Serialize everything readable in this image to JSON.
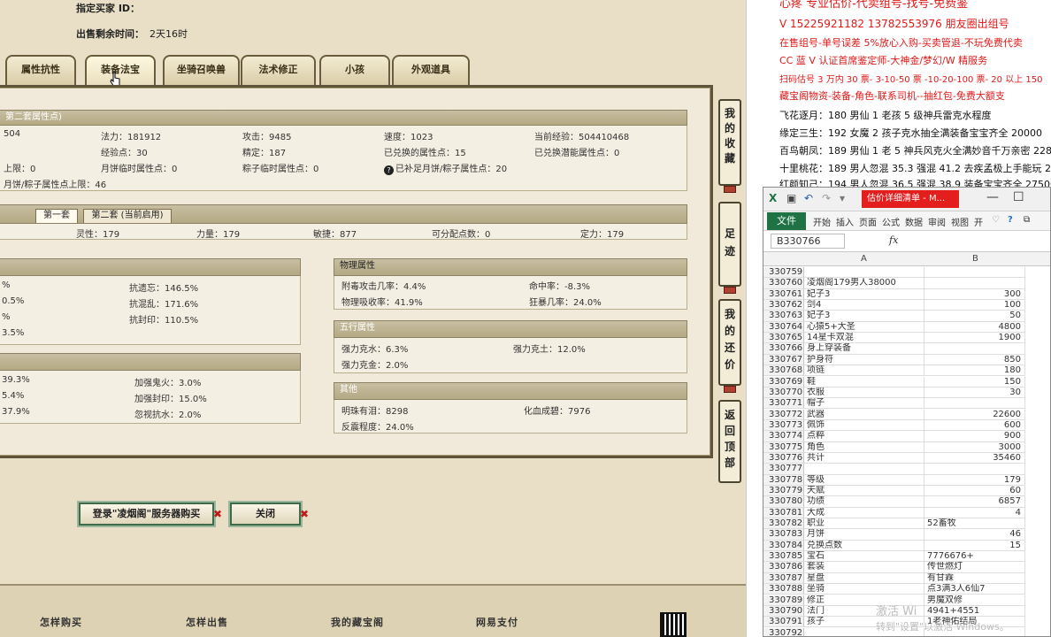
{
  "top_info": {
    "buyer_label": "指定买家 ID：",
    "time_label": "出售剩余时间：",
    "time_value": "2天16时"
  },
  "tabs": [
    "属性抗性",
    "装备法宝",
    "坐骑召唤兽",
    "法术修正",
    "小孩",
    "外观道具"
  ],
  "attr_section": {
    "header": "第二套属性点)",
    "row1": [
      "504",
      "法力：181912",
      "攻击：9485",
      "速度：1023",
      "当前经验：504410468"
    ],
    "row2": [
      "经验点：30",
      "精定：187",
      "已兑换的属性点：15",
      "已兑换潜能属性点：0"
    ],
    "row3": [
      "上限：0",
      "月饼临时属性点：0",
      "粽子临时属性点：0",
      "已补足月饼/粽子属性点：20"
    ],
    "row4": "月饼/粽子属性点上限：46"
  },
  "set_section": {
    "tab1": "第一套",
    "tab2": "第二套 (当前启用)",
    "values": [
      "灵性：179",
      "力量：179",
      "敏捷：877",
      "可分配点数：0",
      "定力：179"
    ]
  },
  "resist_left_top": {
    "rows": [
      [
        "%",
        "抗遗忘：146.5%"
      ],
      [
        "0.5%",
        "抗混乱：171.6%"
      ],
      [
        "%",
        "抗封印：110.5%"
      ],
      [
        "3.5%",
        ""
      ]
    ]
  },
  "resist_left_bottom": {
    "rows": [
      [
        "39.3%",
        "加强鬼火：3.0%"
      ],
      [
        "5.4%",
        "加强封印：15.0%"
      ],
      [
        "37.9%",
        "忽视抗水：2.0%"
      ]
    ]
  },
  "physical": {
    "header": "物理属性",
    "rows": [
      [
        "附毒攻击几率：4.4%",
        "命中率：-8.3%"
      ],
      [
        "物理吸收率：41.9%",
        "狂暴几率：24.0%"
      ]
    ]
  },
  "five_elements": {
    "header": "五行属性",
    "rows": [
      [
        "强力克水：6.3%",
        "强力克土：12.0%"
      ],
      [
        "强力克金：2.0%",
        ""
      ]
    ]
  },
  "other": {
    "header": "其他",
    "rows": [
      [
        "明珠有泪：8298",
        "化血成碧：7976"
      ],
      [
        "反震程度：24.0%",
        ""
      ]
    ]
  },
  "rail": {
    "collect": "我的收藏",
    "footprint": "足迹",
    "bargain": "我的还价",
    "back_top": "返回顶部"
  },
  "bottom_buttons": {
    "login_buy": "登录\"凌烟阁\"服务器购买",
    "close": "关闭"
  },
  "footer_links": [
    "怎样购买",
    "怎样出售",
    "我的藏宝阁",
    "网易支付"
  ],
  "ads": {
    "red_lines": [
      "心疼  专业估价-代卖组号-找号-免费鉴",
      "V 15225921182   13782553976 朋友圈出组号",
      "在售组号-单号误差 5%放心入购-买卖管退-不玩免费代卖",
      "CC 蓝 V 认证首席鉴定师-大神金/梦幻/W 精服务",
      "扫码估号 3 万内 30 票- 3-10-50 票   -10-20-100 票- 20 以上 150",
      "藏宝阁物资-装备-角色-联系司机--抽红包-免费大额支"
    ],
    "black_lines": [
      "飞花逐月：180 男仙 1 老孩 5 级神兵雷克水程度",
      "缘定三生：192 女魔 2 孩子克水抽全满装备宝宝齐全 20000",
      "百鸟朝凤：189 男仙 1 老 5 神兵风克火全满妙音千万亲密 228",
      "十里桃花：189 男人忽混 35.3 强混 41.2 去疾孟极上手能玩 26",
      "红颜知己：194 男人忽混 36.5 强混 38.9 装备宝宝齐全 27500"
    ]
  },
  "excel": {
    "title": "估价详细清单 - M...",
    "file_tab": "文件",
    "ribbon_tabs": [
      "开始",
      "插入",
      "页面",
      "公式",
      "数据",
      "审阅",
      "视图",
      "开"
    ],
    "name_box": "B330766",
    "fx": "fx",
    "col_a": "A",
    "col_b": "B",
    "rows": [
      {
        "n": "330759",
        "a": "",
        "b": "",
        "t": "num"
      },
      {
        "n": "330760",
        "a": "凌烟阁179男人38000",
        "b": "",
        "t": "num"
      },
      {
        "n": "330761",
        "a": "妃子3",
        "b": "300",
        "t": "num"
      },
      {
        "n": "330762",
        "a": "剑4",
        "b": "100",
        "t": "num"
      },
      {
        "n": "330763",
        "a": "妃子3",
        "b": "50",
        "t": "num"
      },
      {
        "n": "330764",
        "a": "心猿5+大圣",
        "b": "4800",
        "t": "num"
      },
      {
        "n": "330765",
        "a": "14星卡双混",
        "b": "1900",
        "t": "num"
      },
      {
        "n": "330766",
        "a": "身上穿装备",
        "b": "",
        "t": "num"
      },
      {
        "n": "330767",
        "a": "护身符",
        "b": "850",
        "t": "num"
      },
      {
        "n": "330768",
        "a": "项链",
        "b": "180",
        "t": "num"
      },
      {
        "n": "330769",
        "a": "鞋",
        "b": "150",
        "t": "num"
      },
      {
        "n": "330770",
        "a": "衣服",
        "b": "30",
        "t": "num"
      },
      {
        "n": "330771",
        "a": "帽子",
        "b": "",
        "t": "num"
      },
      {
        "n": "330772",
        "a": "武器",
        "b": "22600",
        "t": "num"
      },
      {
        "n": "330773",
        "a": "佩饰",
        "b": "600",
        "t": "num"
      },
      {
        "n": "330774",
        "a": "点粹",
        "b": "900",
        "t": "num"
      },
      {
        "n": "330775",
        "a": "角色",
        "b": "3000",
        "t": "num"
      },
      {
        "n": "330776",
        "a": "共计",
        "b": "35460",
        "t": "num"
      },
      {
        "n": "330777",
        "a": "",
        "b": "",
        "t": "num"
      },
      {
        "n": "330778",
        "a": "等级",
        "b": "179",
        "t": "num"
      },
      {
        "n": "330779",
        "a": "天赋",
        "b": "60",
        "t": "num"
      },
      {
        "n": "330780",
        "a": "功绩",
        "b": "6857",
        "t": "num"
      },
      {
        "n": "330781",
        "a": "大成",
        "b": "4",
        "t": "num"
      },
      {
        "n": "330782",
        "a": "职业",
        "b": "52畜牧",
        "t": "txt"
      },
      {
        "n": "330783",
        "a": "月饼",
        "b": "46",
        "t": "num"
      },
      {
        "n": "330784",
        "a": "兑换点数",
        "b": "15",
        "t": "num"
      },
      {
        "n": "330785",
        "a": "宝石",
        "b": "7776676+",
        "t": "txt"
      },
      {
        "n": "330786",
        "a": "套装",
        "b": "传世燃灯",
        "t": "txt"
      },
      {
        "n": "330787",
        "a": "星盘",
        "b": "有甘霖",
        "t": "txt"
      },
      {
        "n": "330788",
        "a": "坐骑",
        "b": "点3满3人6仙7",
        "t": "txt"
      },
      {
        "n": "330789",
        "a": "修正",
        "b": "男魔双修",
        "t": "txt"
      },
      {
        "n": "330790",
        "a": "法门",
        "b": "4941+4551",
        "t": "txt"
      },
      {
        "n": "330791",
        "a": "孩子",
        "b": "1老神佑结局",
        "t": "txt"
      },
      {
        "n": "330792",
        "a": "",
        "b": "",
        "t": "num"
      }
    ]
  },
  "watermark": {
    "line1": "激活 Wi",
    "line2": "转到\"设置\"以激活 Windows。"
  }
}
